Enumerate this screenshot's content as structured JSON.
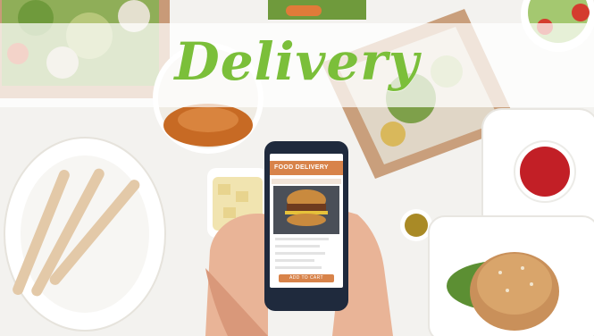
{
  "headline": "Delivery",
  "phone": {
    "app_title": "FOOD DELIVERY",
    "cart_button": "ADD TO CART"
  },
  "colors": {
    "headline": "#7bbf3a",
    "app_accent": "#d8834a",
    "table": "#f3f2ef"
  }
}
